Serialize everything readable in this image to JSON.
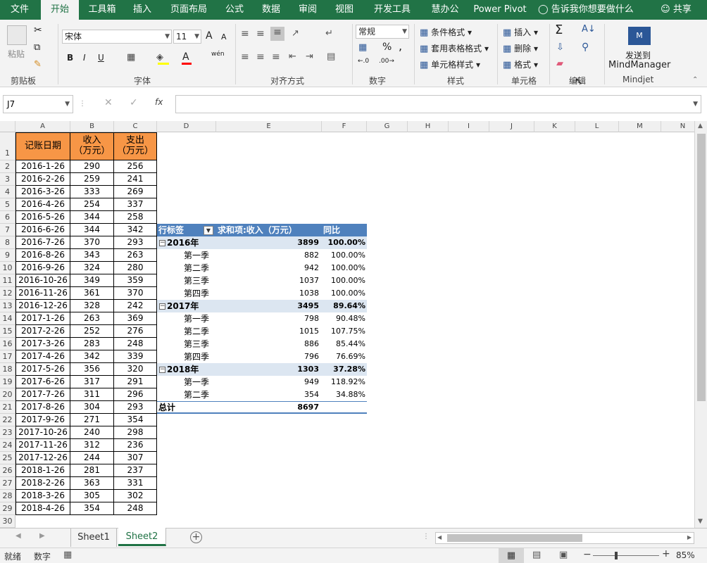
{
  "ribbon_tabs": [
    "文件",
    "开始",
    "工具箱",
    "插入",
    "页面布局",
    "公式",
    "数据",
    "审阅",
    "视图",
    "开发工具",
    "慧办公",
    "Power Pivot"
  ],
  "tell_me": "告诉我你想要做什么",
  "share": "共享",
  "clipboard": {
    "paste": "粘贴",
    "label": "剪贴板"
  },
  "font": {
    "name": "宋体",
    "size": "11",
    "bold": "B",
    "italic": "I",
    "underline": "U",
    "grow": "A",
    "shrink": "A",
    "color_a": "A",
    "phonetic": "wén",
    "label": "字体"
  },
  "alignment": {
    "label": "对齐方式"
  },
  "number": {
    "format": "常规",
    "percent": "%",
    "comma": ",",
    "label": "数字"
  },
  "styles": {
    "cond": "条件格式",
    "table": "套用表格格式",
    "cell": "单元格样式",
    "label": "样式"
  },
  "cells": {
    "insert": "插入",
    "delete": "删除",
    "format": "格式",
    "label": "单元格"
  },
  "editing": {
    "sigma": "Σ",
    "label": "编辑"
  },
  "mindjet": {
    "send": "发送到",
    "app": "MindManager",
    "label": "Mindjet"
  },
  "formula_bar": {
    "name_box": "J7",
    "fx": "fx",
    "formula": ""
  },
  "columns": [
    "A",
    "B",
    "C",
    "D",
    "E",
    "F",
    "G",
    "H",
    "I",
    "J",
    "K",
    "L",
    "M",
    "N"
  ],
  "rows": [
    "1",
    "2",
    "3",
    "4",
    "5",
    "6",
    "7",
    "8",
    "9",
    "10",
    "11",
    "12",
    "13",
    "14",
    "15",
    "16",
    "17",
    "18",
    "19",
    "20",
    "21",
    "22",
    "23",
    "24",
    "25",
    "26",
    "27",
    "28",
    "29",
    "30"
  ],
  "table_header": {
    "date": "记账日期",
    "income": "收入\n（万元）",
    "expense": "支出\n（万元）"
  },
  "table_rows": [
    [
      "2016-1-26",
      "290",
      "256"
    ],
    [
      "2016-2-26",
      "259",
      "241"
    ],
    [
      "2016-3-26",
      "333",
      "269"
    ],
    [
      "2016-4-26",
      "254",
      "337"
    ],
    [
      "2016-5-26",
      "344",
      "258"
    ],
    [
      "2016-6-26",
      "344",
      "342"
    ],
    [
      "2016-7-26",
      "370",
      "293"
    ],
    [
      "2016-8-26",
      "343",
      "263"
    ],
    [
      "2016-9-26",
      "324",
      "280"
    ],
    [
      "2016-10-26",
      "349",
      "359"
    ],
    [
      "2016-11-26",
      "361",
      "370"
    ],
    [
      "2016-12-26",
      "328",
      "242"
    ],
    [
      "2017-1-26",
      "263",
      "369"
    ],
    [
      "2017-2-26",
      "252",
      "276"
    ],
    [
      "2017-3-26",
      "283",
      "248"
    ],
    [
      "2017-4-26",
      "342",
      "339"
    ],
    [
      "2017-5-26",
      "356",
      "320"
    ],
    [
      "2017-6-26",
      "317",
      "291"
    ],
    [
      "2017-7-26",
      "311",
      "296"
    ],
    [
      "2017-8-26",
      "304",
      "293"
    ],
    [
      "2017-9-26",
      "271",
      "354"
    ],
    [
      "2017-10-26",
      "240",
      "298"
    ],
    [
      "2017-11-26",
      "312",
      "236"
    ],
    [
      "2017-12-26",
      "244",
      "307"
    ],
    [
      "2018-1-26",
      "281",
      "237"
    ],
    [
      "2018-2-26",
      "363",
      "331"
    ],
    [
      "2018-3-26",
      "305",
      "302"
    ],
    [
      "2018-4-26",
      "354",
      "248"
    ]
  ],
  "pivot": {
    "header": {
      "row_label": "行标签",
      "sum_label": "求和项:收入（万元）",
      "yoy": "同比"
    },
    "rows": [
      {
        "type": "year",
        "label": "2016年",
        "sum": "3899",
        "yoy": "100.00%"
      },
      {
        "type": "q",
        "label": "第一季",
        "sum": "882",
        "yoy": "100.00%"
      },
      {
        "type": "q",
        "label": "第二季",
        "sum": "942",
        "yoy": "100.00%"
      },
      {
        "type": "q",
        "label": "第三季",
        "sum": "1037",
        "yoy": "100.00%"
      },
      {
        "type": "q",
        "label": "第四季",
        "sum": "1038",
        "yoy": "100.00%"
      },
      {
        "type": "year",
        "label": "2017年",
        "sum": "3495",
        "yoy": "89.64%"
      },
      {
        "type": "q",
        "label": "第一季",
        "sum": "798",
        "yoy": "90.48%"
      },
      {
        "type": "q",
        "label": "第二季",
        "sum": "1015",
        "yoy": "107.75%"
      },
      {
        "type": "q",
        "label": "第三季",
        "sum": "886",
        "yoy": "85.44%"
      },
      {
        "type": "q",
        "label": "第四季",
        "sum": "796",
        "yoy": "76.69%"
      },
      {
        "type": "year",
        "label": "2018年",
        "sum": "1303",
        "yoy": "37.28%"
      },
      {
        "type": "q",
        "label": "第一季",
        "sum": "949",
        "yoy": "118.92%"
      },
      {
        "type": "q",
        "label": "第二季",
        "sum": "354",
        "yoy": "34.88%"
      }
    ],
    "total": {
      "label": "总计",
      "sum": "8697"
    }
  },
  "sheets": [
    "Sheet1",
    "Sheet2"
  ],
  "active_sheet": "Sheet2",
  "status": {
    "ready": "就绪",
    "mode": "数字",
    "zoom": "85%"
  },
  "colors": {
    "excel_green": "#217346",
    "pivot_header": "#4f81bd",
    "pivot_band": "#dce6f1",
    "header_fill": "#f79646"
  }
}
